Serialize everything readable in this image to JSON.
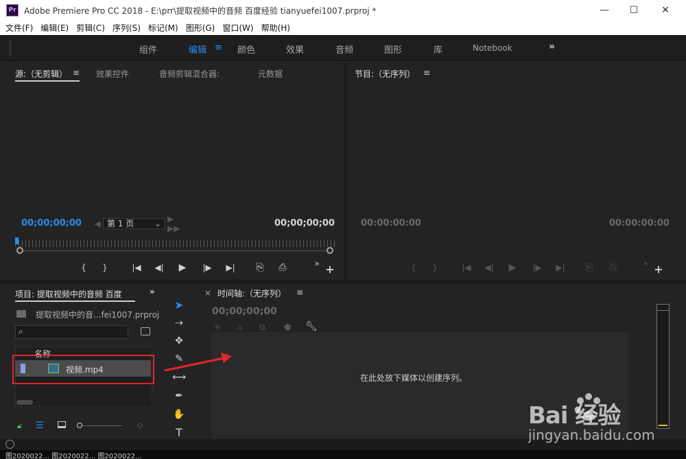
{
  "window": {
    "app_logo": "Pr",
    "title": "Adobe Premiere Pro CC 2018 - E:\\prr\\提取视频中的音频  百度经验 tianyuefei1007.prproj *",
    "controls": {
      "minimize": "—",
      "maximize": "☐",
      "close": "✕"
    }
  },
  "menu": [
    "文件(F)",
    "编辑(E)",
    "剪辑(C)",
    "序列(S)",
    "标记(M)",
    "图形(G)",
    "窗口(W)",
    "帮助(H)"
  ],
  "workspaces": {
    "tabs": [
      "组件",
      "编辑",
      "颜色",
      "效果",
      "音频",
      "图形",
      "库",
      "Notebook"
    ],
    "active": "编辑",
    "more": "»"
  },
  "source_panel": {
    "tabs": [
      "源:（无剪辑）",
      "效果控件",
      "音频剪辑混合器:",
      "元数据"
    ],
    "menu_icon": "≡",
    "timecode_left": "00;00;00;00",
    "timecode_right": "00;00;00;00",
    "page_selector": "第 1 页",
    "page_nav_prev": "◀",
    "page_nav_next": "▶ ▶▶"
  },
  "program_panel": {
    "tab": "节目:（无序列）",
    "menu_icon": "≡",
    "timecode_left": "00:00:00:00",
    "timecode_right": "00:00:00:00"
  },
  "transport": {
    "mark_in": "{",
    "mark_out": "}",
    "go_in": "|◀",
    "step_back": "◀|",
    "play": "▶",
    "step_forward": "|▶",
    "go_out": "▶|",
    "insert": "⎘",
    "overwrite": "⎙",
    "more": "»",
    "add": "+"
  },
  "project_panel": {
    "tab": "项目: 提取视频中的音频 百度",
    "more": "»",
    "file_name": "提取视频中的音...fei1007.prproj",
    "column_name": "名称",
    "items": [
      {
        "name": "视频.mp4"
      }
    ]
  },
  "timeline_panel": {
    "close": "×",
    "tab": "时间轴:（无序列）",
    "menu_icon": "≡",
    "timecode": "00;00;00;00",
    "drop_hint": "在此处放下媒体以创建序列。"
  },
  "taskbar": {
    "items": "图2020022... 图2020022... 图2020022..."
  },
  "watermark": {
    "brand": "Bai  经验",
    "url": "jingyan.baidu.com"
  },
  "colors": {
    "accent": "#2d8ceb",
    "highlight": "#e0262a",
    "panel_bg": "#232323"
  }
}
